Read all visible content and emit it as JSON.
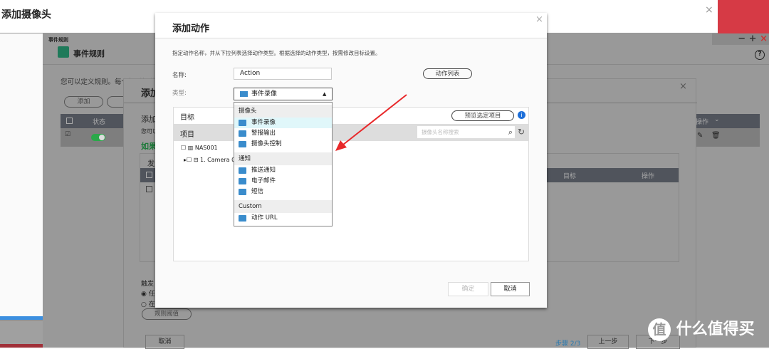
{
  "top_window": {
    "title": "添加摄像头"
  },
  "window_controls": {
    "minimize": "−",
    "maximize": "+",
    "close": "×"
  },
  "event_rules": {
    "small_title": "事件规则",
    "title": "事件规则",
    "description": "您可以定义规则。每个规则规道",
    "add_button": "添加",
    "table_header": {
      "status": "状态",
      "actions": "操作"
    }
  },
  "inner_dialog": {
    "title": "添加",
    "subtitle": "添加",
    "desc": "您可以",
    "green_text": "如果",
    "table_header_first": "发生",
    "col_target": "目标",
    "col_action": "操作",
    "trigger_label": "触发",
    "radio1": "任",
    "radio2": "在",
    "threshold_button": "规则阈值",
    "cancel": "取消",
    "step": "步骤 2/3",
    "prev": "上一步",
    "next": "下一步"
  },
  "dialog": {
    "title": "添加动作",
    "description": "指定动作名称，并从下拉列表选择动作类型。根据选择的动作类型，按需修改目标设置。",
    "name_label": "名称:",
    "name_value": "Action",
    "action_list_button": "动作列表",
    "type_label": "类型:",
    "type_value": "事件录像",
    "target_label": "目标",
    "preview_button": "预览选定项目",
    "items_label": "项目",
    "search_placeholder": "摄像头名称搜索",
    "tree": [
      {
        "label": "NAS001"
      },
      {
        "label": "1. Camera 0"
      }
    ],
    "ok": "确定",
    "cancel": "取消"
  },
  "dropdown": {
    "groups": [
      {
        "label": "摄像头",
        "items": [
          {
            "label": "事件录像",
            "icon": "video-icon",
            "selected": true
          },
          {
            "label": "警报输出",
            "icon": "alarm-icon"
          },
          {
            "label": "摄像头控制",
            "icon": "camera-control-icon"
          }
        ]
      },
      {
        "label": "通知",
        "items": [
          {
            "label": "推送通知",
            "icon": "push-icon"
          },
          {
            "label": "电子邮件",
            "icon": "email-icon"
          },
          {
            "label": "短信",
            "icon": "sms-icon"
          }
        ]
      },
      {
        "label": "Custom",
        "items": [
          {
            "label": "动作 URL",
            "icon": "url-icon"
          }
        ]
      }
    ]
  },
  "watermark": {
    "text": "什么值得买",
    "logo": "值"
  },
  "colors": {
    "accent": "#3a8ccc",
    "arrow": "#e8282a",
    "green": "#2aa84a"
  }
}
